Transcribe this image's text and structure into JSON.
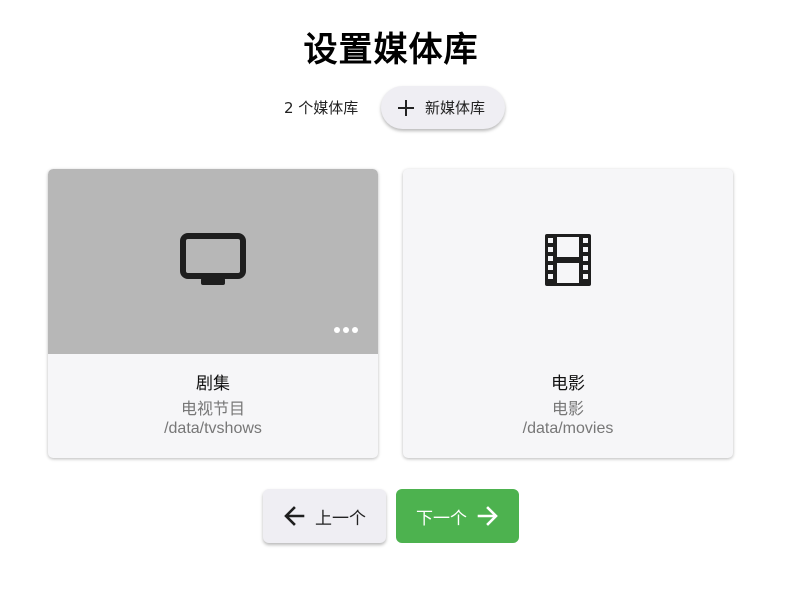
{
  "page": {
    "title": "设置媒体库"
  },
  "toolbar": {
    "library_count": "2 个媒体库",
    "new_library_label": "新媒体库",
    "new_library_icon": "plus-icon"
  },
  "libraries": [
    {
      "name": "剧集",
      "type": "电视节目",
      "path": "/data/tvshows",
      "icon": "tv-icon",
      "thumb_color": "#b7b7b7",
      "menu_icon": "more-dots-icon"
    },
    {
      "name": "电影",
      "type": "电影",
      "path": "/data/movies",
      "icon": "film-icon",
      "thumb_color": "#f6f6f8"
    }
  ],
  "navigation": {
    "prev_label": "上一个",
    "prev_icon": "arrow-left-icon",
    "next_label": "下一个",
    "next_icon": "arrow-right-icon"
  },
  "colors": {
    "accent": "#4db24f",
    "button_bg": "#efeef3",
    "card_bg": "#f6f6f8"
  }
}
